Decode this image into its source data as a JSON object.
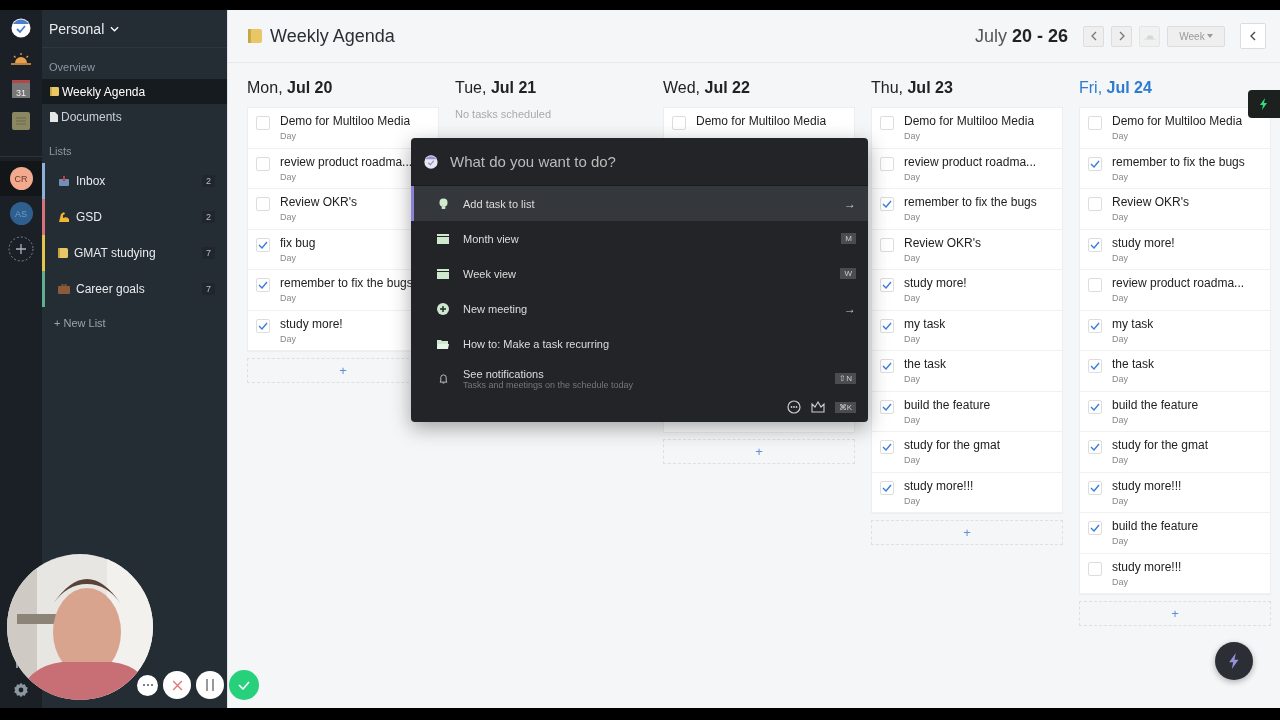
{
  "rail": {
    "calendar_day": "31",
    "avatars": [
      {
        "initials": "CR",
        "color": "#f2a98e",
        "selected": true
      },
      {
        "initials": "AS",
        "color": "#2f5f8f",
        "selected": false
      }
    ]
  },
  "sidebar": {
    "workspace": "Personal",
    "overview_heading": "Overview",
    "items": [
      {
        "label": "Weekly Agenda",
        "kind": "notebook",
        "selected": true
      },
      {
        "label": "Documents",
        "kind": "document",
        "selected": false
      }
    ],
    "lists_heading": "Lists",
    "lists": [
      {
        "label": "Inbox",
        "kind": "inbox",
        "count": "2",
        "color": "#8fb0d8"
      },
      {
        "label": "GSD",
        "kind": "muscle",
        "count": "2",
        "color": "#d9717a"
      },
      {
        "label": "GMAT studying",
        "kind": "notebook",
        "count": "7",
        "color": "#e3c54c"
      },
      {
        "label": "Career goals",
        "kind": "briefcase",
        "count": "7",
        "color": "#5fae8e"
      }
    ],
    "new_list": "+ New List"
  },
  "header": {
    "title": "Weekly Agenda",
    "range": "July **20 - 26**",
    "view": "Week"
  },
  "days": [
    {
      "title": "Mon, **Jul 20**",
      "today": false,
      "add": "+",
      "tasks": [
        {
          "title": "Demo for Multiloo Media",
          "sub": "Day",
          "checked": false
        },
        {
          "title": "review product roadma...",
          "sub": "Day",
          "checked": false
        },
        {
          "title": "Review OKR's",
          "sub": "Day",
          "checked": false
        },
        {
          "title": "fix bug",
          "sub": "Day",
          "checked": true
        },
        {
          "title": "remember to fix the bugs",
          "sub": "Day",
          "checked": true
        },
        {
          "title": "study more!",
          "sub": "Day",
          "checked": true
        }
      ]
    },
    {
      "title": "Tue, **Jul 21**",
      "today": false,
      "empty": "No tasks scheduled"
    },
    {
      "title": "Wed, **Jul 22**",
      "today": false,
      "add": "+",
      "tasks": [
        {
          "title": "Demo for Multiloo Media",
          "checked": false
        }
      ]
    },
    {
      "title": "Thu, **Jul 23**",
      "today": false,
      "add": "+",
      "tasks": [
        {
          "title": "Demo for Multiloo Media",
          "sub": "Day",
          "checked": false
        },
        {
          "title": "review product roadma...",
          "sub": "Day",
          "checked": false
        },
        {
          "title": "remember to fix the bugs",
          "sub": "Day",
          "checked": true
        },
        {
          "title": "Review OKR's",
          "sub": "Day",
          "checked": false
        },
        {
          "title": "study more!",
          "sub": "Day",
          "checked": true
        },
        {
          "title": "my task",
          "sub": "Day",
          "checked": true
        },
        {
          "title": "the task",
          "sub": "Day",
          "checked": true
        },
        {
          "title": "build the feature",
          "sub": "Day",
          "checked": true
        },
        {
          "title": "study for the gmat",
          "sub": "Day",
          "checked": true
        },
        {
          "title": "study more!!!",
          "sub": "Day",
          "checked": true
        }
      ]
    },
    {
      "title": "Fri, **Jul 24**",
      "today": true,
      "add": "+",
      "tasks": [
        {
          "title": "Demo for Multiloo Media",
          "sub": "Day",
          "checked": false
        },
        {
          "title": "remember to fix the bugs",
          "sub": "Day",
          "checked": true
        },
        {
          "title": "Review OKR's",
          "sub": "Day",
          "checked": false
        },
        {
          "title": "study more!",
          "sub": "Day",
          "checked": true
        },
        {
          "title": "review product roadma...",
          "sub": "Day",
          "checked": false
        },
        {
          "title": "my task",
          "sub": "Day",
          "checked": true
        },
        {
          "title": "the task",
          "sub": "Day",
          "checked": true
        },
        {
          "title": "build the feature",
          "sub": "Day",
          "checked": true
        },
        {
          "title": "study for the gmat",
          "sub": "Day",
          "checked": true
        },
        {
          "title": "study more!!!",
          "sub": "Day",
          "checked": true
        },
        {
          "title": "build the feature",
          "sub": "Day",
          "checked": true
        },
        {
          "title": "study more!!!",
          "sub": "Day",
          "checked": false
        }
      ]
    }
  ],
  "palette": {
    "placeholder": "What do you want to do?",
    "commands": [
      {
        "label": "Add task to list",
        "kind": "bulb",
        "selected": true,
        "trail": "→"
      },
      {
        "label": "Month view",
        "kind": "calendar",
        "selected": false,
        "shortcut": "M"
      },
      {
        "label": "Week view",
        "kind": "calendar",
        "selected": false,
        "shortcut": "W"
      },
      {
        "label": "New meeting",
        "kind": "plus",
        "selected": false,
        "trail": "→"
      },
      {
        "label": "How to: Make a task recurring",
        "kind": "folder",
        "selected": false
      },
      {
        "label": "See notifications",
        "detail": "Tasks and meetings on the schedule today",
        "kind": "bell",
        "selected": false,
        "shortcut": "⇧N"
      }
    ],
    "footer_key": "⌘K"
  }
}
